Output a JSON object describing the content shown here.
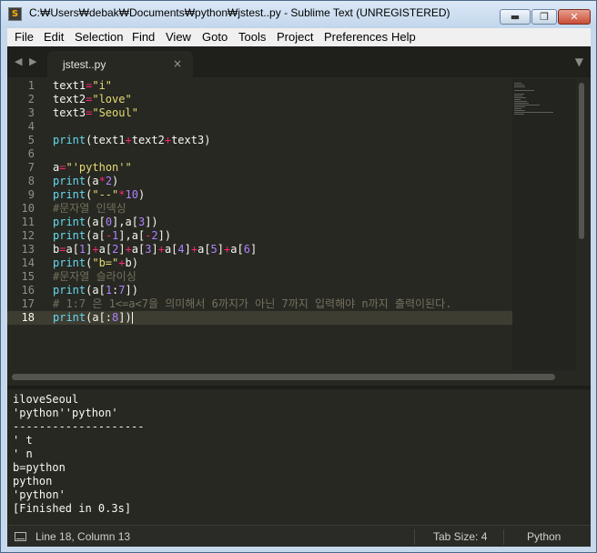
{
  "window": {
    "title": "C:₩Users₩debak₩Documents₩python₩jstest..py - Sublime Text (UNREGISTERED)",
    "app_icon": "S"
  },
  "controls": {
    "minimize": "▬",
    "maximize": "❐",
    "close": "✕"
  },
  "menu": [
    "File",
    "Edit",
    "Selection",
    "Find",
    "View",
    "Goto",
    "Tools",
    "Project",
    "Preferences",
    "Help"
  ],
  "tabbar": {
    "left": "◀",
    "right": "▶",
    "tab_label": "jstest..py",
    "tab_close": "×",
    "overflow": "▼"
  },
  "code": [
    {
      "n": "1",
      "t": [
        [
          "plain",
          "text1"
        ],
        [
          "op",
          "="
        ],
        [
          "str",
          "\"i\""
        ]
      ]
    },
    {
      "n": "2",
      "t": [
        [
          "plain",
          "text2"
        ],
        [
          "op",
          "="
        ],
        [
          "str",
          "\"love\""
        ]
      ]
    },
    {
      "n": "3",
      "t": [
        [
          "plain",
          "text3"
        ],
        [
          "op",
          "="
        ],
        [
          "str",
          "\"Seoul\""
        ]
      ]
    },
    {
      "n": "4",
      "t": []
    },
    {
      "n": "5",
      "t": [
        [
          "fn",
          "print"
        ],
        [
          "plain",
          "(text1"
        ],
        [
          "op",
          "+"
        ],
        [
          "plain",
          "text2"
        ],
        [
          "op",
          "+"
        ],
        [
          "plain",
          "text3)"
        ]
      ]
    },
    {
      "n": "6",
      "t": []
    },
    {
      "n": "7",
      "t": [
        [
          "plain",
          "a"
        ],
        [
          "op",
          "="
        ],
        [
          "str",
          "\"'python'\""
        ]
      ]
    },
    {
      "n": "8",
      "t": [
        [
          "fn",
          "print"
        ],
        [
          "plain",
          "(a"
        ],
        [
          "op",
          "*"
        ],
        [
          "num",
          "2"
        ],
        [
          "plain",
          ")"
        ]
      ]
    },
    {
      "n": "9",
      "t": [
        [
          "fn",
          "print"
        ],
        [
          "plain",
          "("
        ],
        [
          "str",
          "\"--\""
        ],
        [
          "op",
          "*"
        ],
        [
          "num",
          "10"
        ],
        [
          "plain",
          ")"
        ]
      ]
    },
    {
      "n": "10",
      "t": [
        [
          "cmt",
          "#문자열 인덱싱"
        ]
      ]
    },
    {
      "n": "11",
      "t": [
        [
          "fn",
          "print"
        ],
        [
          "plain",
          "(a["
        ],
        [
          "num",
          "0"
        ],
        [
          "plain",
          "],a["
        ],
        [
          "num",
          "3"
        ],
        [
          "plain",
          "])"
        ]
      ]
    },
    {
      "n": "12",
      "t": [
        [
          "fn",
          "print"
        ],
        [
          "plain",
          "(a["
        ],
        [
          "op",
          "-"
        ],
        [
          "num",
          "1"
        ],
        [
          "plain",
          "],a["
        ],
        [
          "op",
          "-"
        ],
        [
          "num",
          "2"
        ],
        [
          "plain",
          "])"
        ]
      ]
    },
    {
      "n": "13",
      "t": [
        [
          "plain",
          "b"
        ],
        [
          "op",
          "="
        ],
        [
          "plain",
          "a["
        ],
        [
          "num",
          "1"
        ],
        [
          "plain",
          "]"
        ],
        [
          "op",
          "+"
        ],
        [
          "plain",
          "a["
        ],
        [
          "num",
          "2"
        ],
        [
          "plain",
          "]"
        ],
        [
          "op",
          "+"
        ],
        [
          "plain",
          "a["
        ],
        [
          "num",
          "3"
        ],
        [
          "plain",
          "]"
        ],
        [
          "op",
          "+"
        ],
        [
          "plain",
          "a["
        ],
        [
          "num",
          "4"
        ],
        [
          "plain",
          "]"
        ],
        [
          "op",
          "+"
        ],
        [
          "plain",
          "a["
        ],
        [
          "num",
          "5"
        ],
        [
          "plain",
          "]"
        ],
        [
          "op",
          "+"
        ],
        [
          "plain",
          "a["
        ],
        [
          "num",
          "6"
        ],
        [
          "plain",
          "]"
        ]
      ]
    },
    {
      "n": "14",
      "t": [
        [
          "fn",
          "print"
        ],
        [
          "plain",
          "("
        ],
        [
          "str",
          "\"b=\""
        ],
        [
          "op",
          "+"
        ],
        [
          "plain",
          "b)"
        ]
      ]
    },
    {
      "n": "15",
      "t": [
        [
          "cmt",
          "#문자열 슬라이싱"
        ]
      ]
    },
    {
      "n": "16",
      "t": [
        [
          "fn",
          "print"
        ],
        [
          "plain",
          "(a["
        ],
        [
          "num",
          "1"
        ],
        [
          "plain",
          ":"
        ],
        [
          "num",
          "7"
        ],
        [
          "plain",
          "])"
        ]
      ]
    },
    {
      "n": "17",
      "t": [
        [
          "cmt",
          "# 1:7 은 1<=a<7을 의미해서 6까지가 아닌 7까지 입력해야 n까지 출력이된다."
        ]
      ]
    },
    {
      "n": "18",
      "t": [
        [
          "fn",
          "print"
        ],
        [
          "plain",
          "(a[:"
        ],
        [
          "num",
          "8"
        ],
        [
          "plain",
          "])"
        ]
      ],
      "active": true
    }
  ],
  "output": [
    "iloveSeoul",
    "'python''python'",
    "--------------------",
    "' t",
    "' n",
    "b=python",
    "python",
    "'python'",
    "[Finished in 0.3s]"
  ],
  "status": {
    "position": "Line 18, Column 13",
    "tab_size": "Tab Size: 4",
    "syntax": "Python"
  }
}
